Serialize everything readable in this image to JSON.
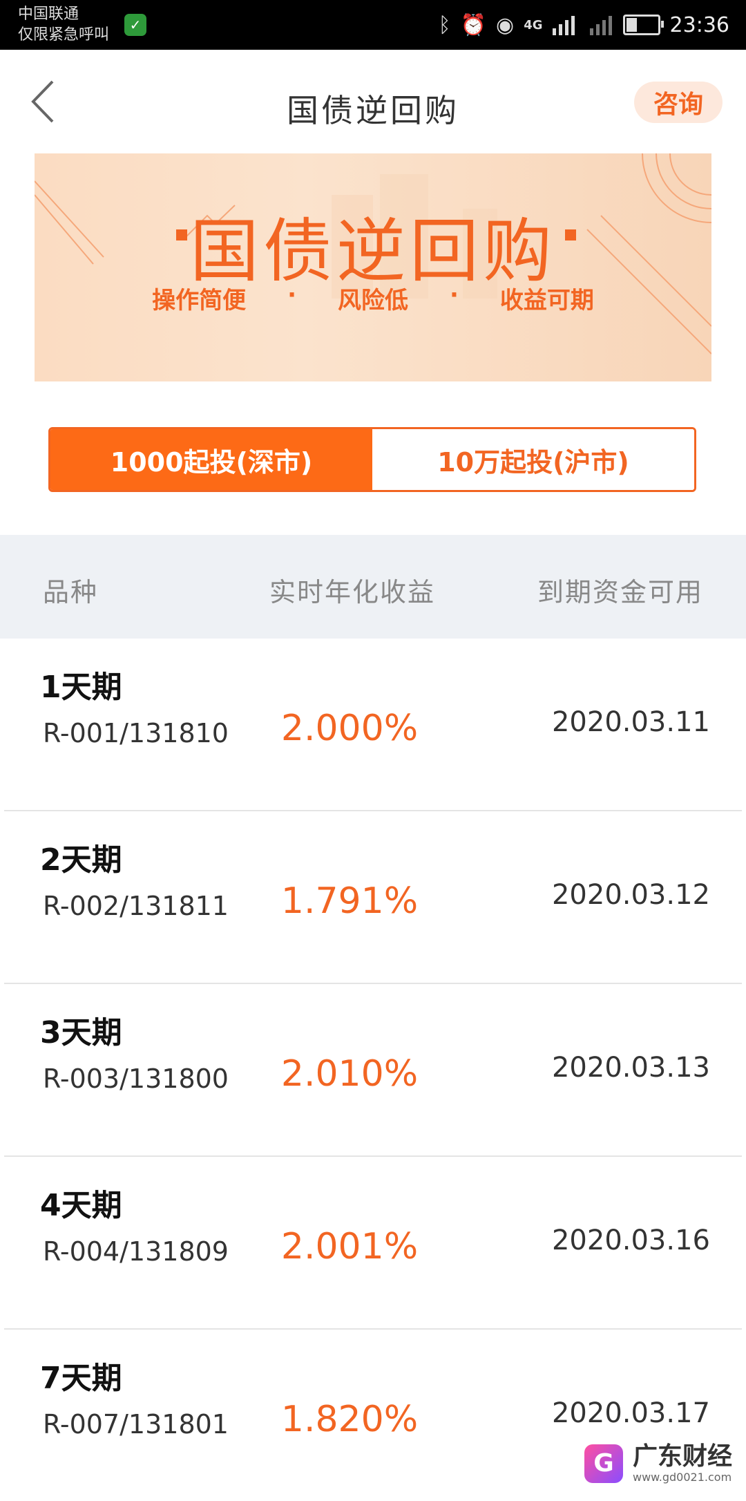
{
  "status_bar": {
    "carrier": "中国联通",
    "carrier_note": "仅限紧急呼叫",
    "network": "4G",
    "time": "23:36",
    "battery_level": 0.35
  },
  "header": {
    "title": "国债逆回购",
    "consult_label": "咨询"
  },
  "banner": {
    "title": "国债逆回购",
    "features": [
      "操作简便",
      "风险低",
      "收益可期"
    ]
  },
  "tabs": [
    {
      "label": "1000起投(深市)",
      "active": true
    },
    {
      "label": "10万起投(沪市)",
      "active": false
    }
  ],
  "table": {
    "headers": [
      "品种",
      "实时年化收益",
      "到期资金可用"
    ],
    "rows": [
      {
        "name": "1天期",
        "code": "R-001/131810",
        "rate": "2.000%",
        "date": "2020.03.11"
      },
      {
        "name": "2天期",
        "code": "R-002/131811",
        "rate": "1.791%",
        "date": "2020.03.12"
      },
      {
        "name": "3天期",
        "code": "R-003/131800",
        "rate": "2.010%",
        "date": "2020.03.13"
      },
      {
        "name": "4天期",
        "code": "R-004/131809",
        "rate": "2.001%",
        "date": "2020.03.16"
      },
      {
        "name": "7天期",
        "code": "R-007/131801",
        "rate": "1.820%",
        "date": "2020.03.17"
      }
    ]
  },
  "watermark": {
    "logo_letter": "G",
    "name": "广东财经",
    "url": "www.gd0021.com"
  },
  "colors": {
    "accent": "#f26522",
    "tab_active": "#fd6a16",
    "table_header_bg": "#eef1f5"
  }
}
